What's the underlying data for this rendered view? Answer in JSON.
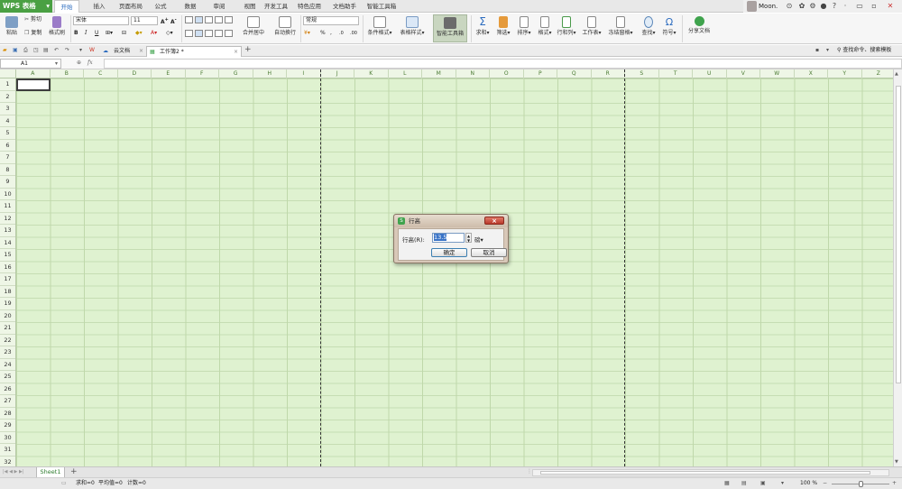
{
  "app": {
    "logo": "WPS 表格"
  },
  "menu": {
    "tabs": [
      "开始",
      "插入",
      "页面布局",
      "公式",
      "数据",
      "审阅",
      "视图",
      "开发工具",
      "特色应用",
      "文档助手",
      "智能工具箱"
    ],
    "active": "开始",
    "user": "Moon."
  },
  "ribbon": {
    "paste": "粘贴",
    "cut": "剪切",
    "copy": "复制",
    "format_painter": "格式刷",
    "font_name": "宋体",
    "font_size": "11",
    "merge_center": "合并居中",
    "wrap_text": "自动换行",
    "number_format": "常规",
    "percent": "%",
    "conditional_format": "条件格式",
    "table_style": "表格样式",
    "smart_toolbox": "智能工具箱",
    "sum": "求和",
    "filter": "筛选",
    "sort": "排序",
    "format": "格式",
    "row_col": "行和列",
    "worksheet": "工作表",
    "freeze": "冻结窗格",
    "find": "查找",
    "symbol": "符号",
    "share": "分享文档",
    "search_cmd": "查找命令、搜索模板"
  },
  "doc_tabs": {
    "cloud": "云文档",
    "workbook": "工作簿2 *"
  },
  "formula_bar": {
    "cell_ref": "A1",
    "fx": "fx"
  },
  "sheet": {
    "columns": [
      "A",
      "B",
      "C",
      "D",
      "E",
      "F",
      "G",
      "H",
      "I",
      "J",
      "K",
      "L",
      "M",
      "N",
      "O",
      "P",
      "Q",
      "R",
      "S",
      "T",
      "U",
      "V",
      "W",
      "X",
      "Y",
      "Z"
    ],
    "rows": [
      "1",
      "2",
      "3",
      "4",
      "5",
      "6",
      "7",
      "8",
      "9",
      "10",
      "11",
      "12",
      "13",
      "14",
      "15",
      "16",
      "17",
      "18",
      "19",
      "20",
      "21",
      "22",
      "23",
      "24",
      "25",
      "26",
      "27",
      "28",
      "29",
      "30",
      "31",
      "32"
    ],
    "grid_color": "#dff2d0"
  },
  "dialog": {
    "title": "行高",
    "label": "行高(R):",
    "value": "13.5",
    "unit": "磅",
    "ok": "确定",
    "cancel": "取消"
  },
  "sheetbar": {
    "sheet_name": "Sheet1"
  },
  "status": {
    "sum": "求和=0",
    "avg": "平均值=0",
    "count": "计数=0",
    "zoom": "100 %"
  }
}
